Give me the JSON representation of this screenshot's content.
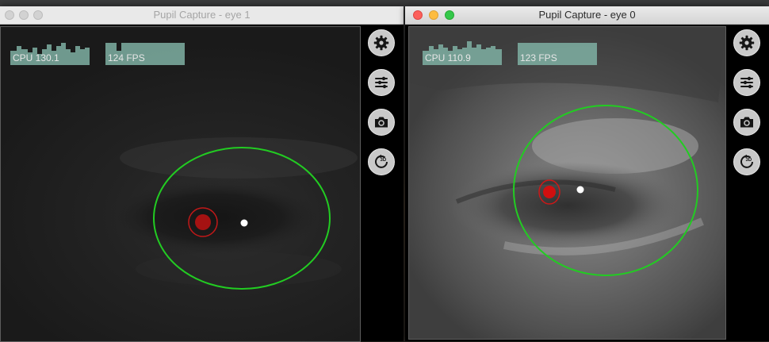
{
  "windows": [
    {
      "title": "Pupil Capture - eye 1",
      "active": false,
      "cpu_label": "CPU 130.1",
      "fps_label": "124 FPS"
    },
    {
      "title": "Pupil Capture - eye 0",
      "active": true,
      "cpu_label": "CPU 110.9",
      "fps_label": "123 FPS"
    }
  ],
  "toolbar": {
    "icons": [
      "gear-icon",
      "sliders-icon",
      "camera-icon",
      "3d-rotate-icon"
    ]
  },
  "colors": {
    "graph_fill": "#7fb0a3",
    "eye_ellipse": "#22cc22",
    "pupil_fill": "#b31111",
    "pupil_ring": "#d82020",
    "traffic_close": "#fc605b",
    "traffic_min": "#fdbc40",
    "traffic_max": "#34c84a"
  }
}
